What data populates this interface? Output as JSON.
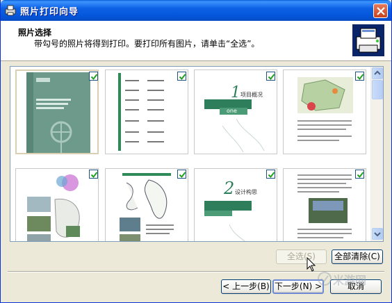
{
  "window": {
    "title": "照片打印向导",
    "close_icon": "close-icon"
  },
  "header": {
    "title": "照片选择",
    "description": "带勾号的照片将得到打印。要打印所有图片，请单击“全选”。"
  },
  "thumbnails": [
    {
      "page": "cover",
      "selected": true,
      "checked": true
    },
    {
      "page": "contents",
      "selected": false,
      "checked": true
    },
    {
      "page": "chapter-1",
      "selected": false,
      "checked": true
    },
    {
      "page": "map-page",
      "selected": false,
      "checked": true
    },
    {
      "page": "map-photos",
      "selected": false,
      "checked": true
    },
    {
      "page": "sketch-page",
      "selected": false,
      "checked": true
    },
    {
      "page": "chapter-2",
      "selected": false,
      "checked": true
    },
    {
      "page": "text-photos",
      "selected": false,
      "checked": true
    }
  ],
  "chapter_1_text": "1",
  "chapter_1_label": "项目概况",
  "chapter_1_sub": "one",
  "chapter_2_text": "2",
  "chapter_2_label": "设计构思",
  "buttons": {
    "select_all": "全选(S)",
    "clear_all": "全部清除(C)",
    "back": "< 上一步(B)",
    "next": "下一步(N) >",
    "cancel": "取消"
  },
  "watermark": "米游网",
  "colors": {
    "accent_green": "#2E8B57",
    "titlebar_blue": "#0454D8"
  }
}
